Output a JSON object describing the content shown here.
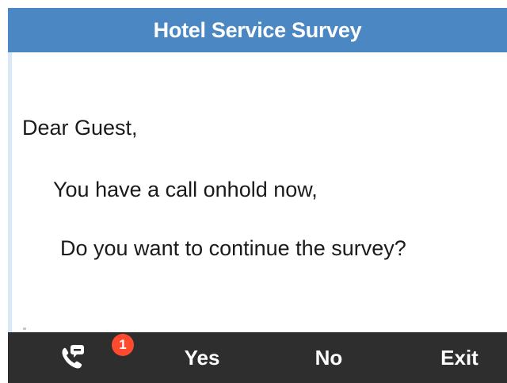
{
  "header": {
    "title": "Hotel Service Survey"
  },
  "message": {
    "greeting": "Dear Guest,",
    "line1": "You have a call onhold now,",
    "line2": "Do you want to continue the survey?"
  },
  "softkeys": {
    "call_icon": "phone-chat-icon",
    "badge_count": "1",
    "yes_label": "Yes",
    "no_label": "No",
    "exit_label": "Exit"
  },
  "colors": {
    "title_bar": "#4b87c2",
    "softkey_bar": "#2e2e2e",
    "badge": "#ff4a2e",
    "scroll_track": "#d9e8f6"
  }
}
